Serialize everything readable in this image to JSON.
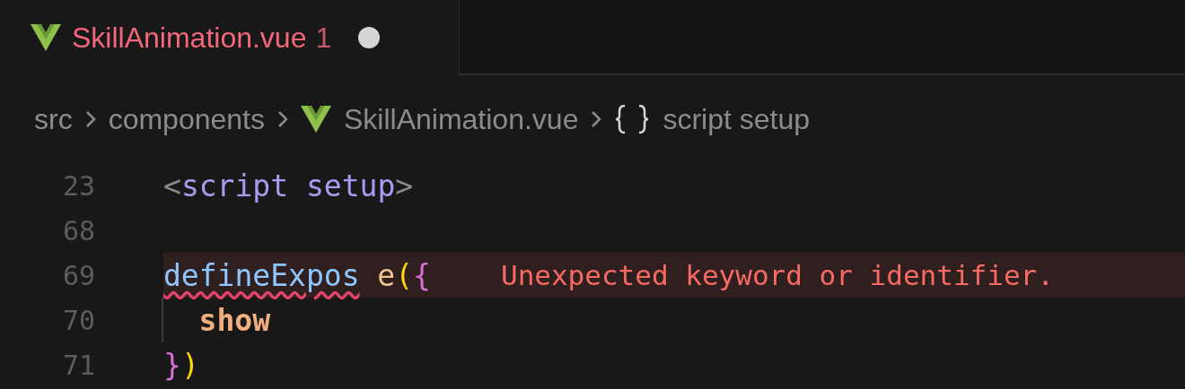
{
  "tab": {
    "title": "SkillAnimation.vue",
    "problems": "1",
    "modified": true
  },
  "breadcrumbs": [
    {
      "kind": "folder",
      "label": "src"
    },
    {
      "kind": "folder",
      "label": "components"
    },
    {
      "kind": "file",
      "label": "SkillAnimation.vue"
    },
    {
      "kind": "symbol",
      "label": "script setup"
    }
  ],
  "lines": [
    {
      "number": "23",
      "indent_guide": false,
      "tokens": [
        {
          "kind": "punct",
          "text": "<"
        },
        {
          "kind": "tag",
          "text": "script setup"
        },
        {
          "kind": "punct",
          "text": ">"
        }
      ]
    },
    {
      "number": "68",
      "indent_guide": false
    },
    {
      "number": "69",
      "indent_guide": false,
      "error_message": "Unexpected keyword or identifier.",
      "tokens": [
        {
          "kind": "func",
          "text": "defineExpos",
          "squiggle": true
        },
        {
          "kind": "ident",
          "text": "e",
          "space_before": true
        },
        {
          "kind": "paren",
          "text": "("
        },
        {
          "kind": "brace",
          "text": "{"
        }
      ]
    },
    {
      "number": "70",
      "indent_guide": true,
      "tokens": [
        {
          "kind": "prop",
          "text": "show"
        }
      ]
    },
    {
      "number": "71",
      "indent_guide": false,
      "tokens": [
        {
          "kind": "brace",
          "text": "}"
        },
        {
          "kind": "paren",
          "text": ")"
        }
      ]
    }
  ]
}
